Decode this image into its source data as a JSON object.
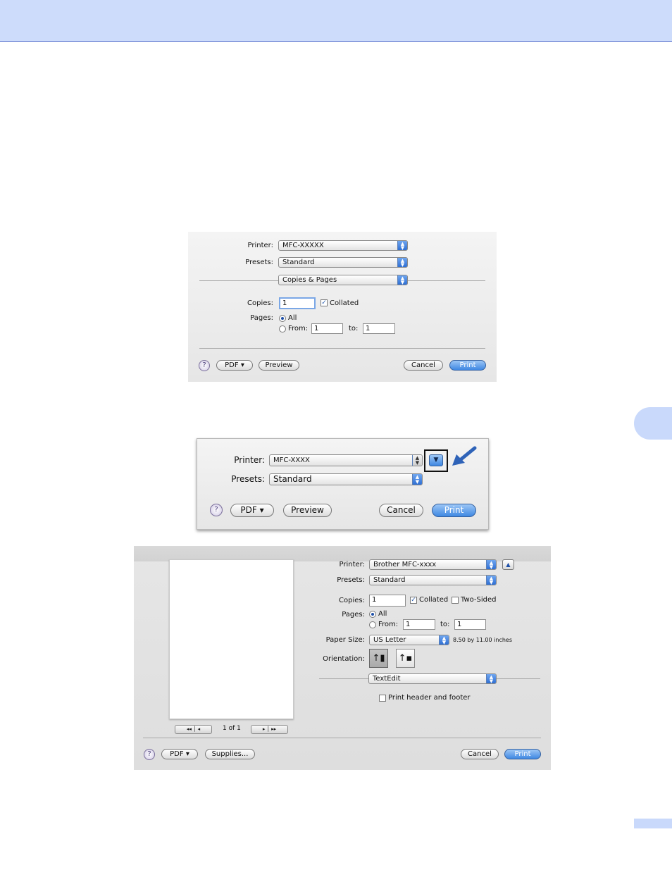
{
  "dialog1": {
    "printer_label": "Printer:",
    "printer_value": "MFC-XXXXX",
    "presets_label": "Presets:",
    "presets_value": "Standard",
    "panel_value": "Copies & Pages",
    "copies_label": "Copies:",
    "copies_value": "1",
    "collated_label": "Collated",
    "pages_label": "Pages:",
    "all_label": "All",
    "from_label": "From:",
    "from_value": "1",
    "to_label": "to:",
    "to_value": "1",
    "pdf_label": "PDF ▾",
    "preview_label": "Preview",
    "cancel_label": "Cancel",
    "print_label": "Print"
  },
  "dialog2": {
    "printer_label": "Printer:",
    "printer_value": "MFC-XXXX",
    "presets_label": "Presets:",
    "presets_value": "Standard",
    "pdf_label": "PDF ▾",
    "preview_label": "Preview",
    "cancel_label": "Cancel",
    "print_label": "Print"
  },
  "dialog3": {
    "printer_label": "Printer:",
    "printer_value": "Brother MFC-xxxx",
    "presets_label": "Presets:",
    "presets_value": "Standard",
    "copies_label": "Copies:",
    "copies_value": "1",
    "collated_label": "Collated",
    "two_sided_label": "Two-Sided",
    "pages_label": "Pages:",
    "all_label": "All",
    "from_label": "From:",
    "from_value": "1",
    "to_label": "to:",
    "to_value": "1",
    "paper_size_label": "Paper Size:",
    "paper_size_value": "US Letter",
    "paper_dims": "8.50 by 11.00 inches",
    "orientation_label": "Orientation:",
    "app_panel_value": "TextEdit",
    "header_footer_label": "Print header and footer",
    "page_count": "1 of 1",
    "pdf_label": "PDF ▾",
    "supplies_label": "Supplies...",
    "cancel_label": "Cancel",
    "print_label": "Print"
  },
  "colors": {
    "band": "#cddcfb",
    "band_line": "#3a5bc7",
    "accent_blue": "#3f88e2",
    "arrow_blue": "#2f63b8"
  }
}
